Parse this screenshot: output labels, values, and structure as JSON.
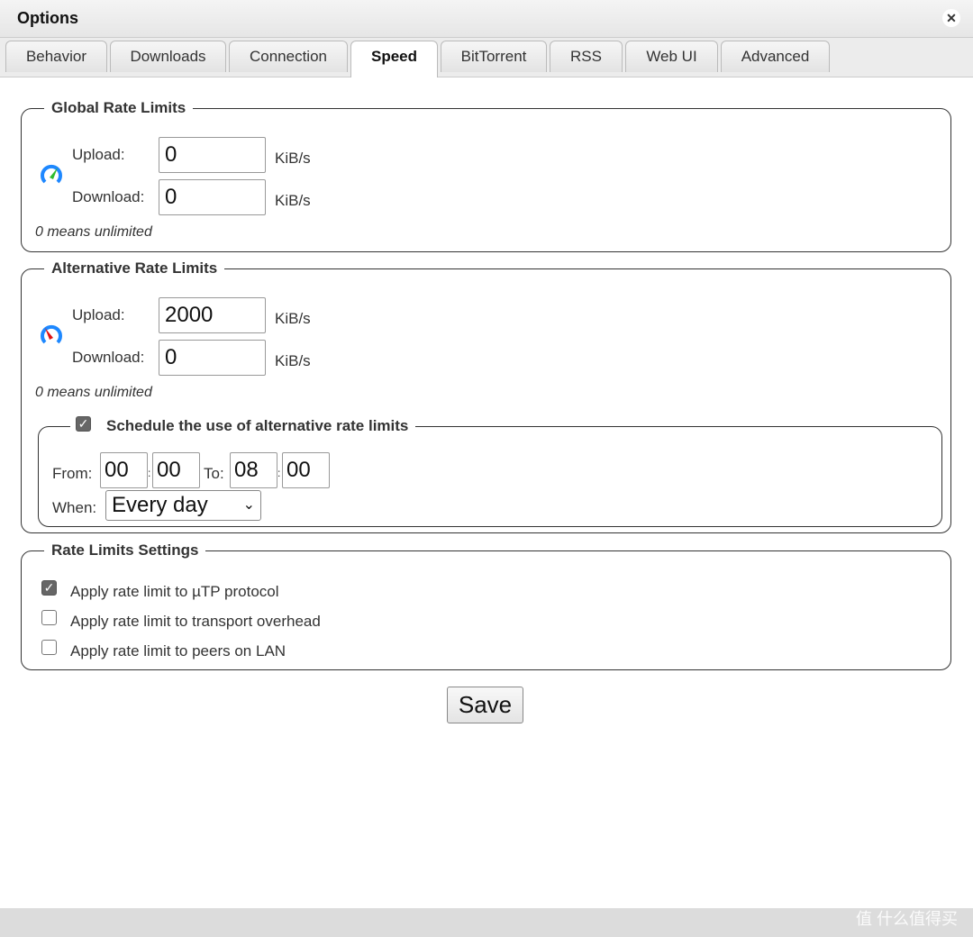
{
  "window": {
    "title": "Options",
    "close_icon": "close-icon"
  },
  "tabs": [
    {
      "label": "Behavior"
    },
    {
      "label": "Downloads"
    },
    {
      "label": "Connection"
    },
    {
      "label": "Speed",
      "active": true
    },
    {
      "label": "BitTorrent"
    },
    {
      "label": "RSS"
    },
    {
      "label": "Web UI"
    },
    {
      "label": "Advanced"
    }
  ],
  "global": {
    "legend": "Global Rate Limits",
    "upload_label": "Upload:",
    "upload_value": "0",
    "download_label": "Download:",
    "download_value": "0",
    "unit": "KiB/s",
    "note": "0 means unlimited",
    "icon": "speedometer-green-icon"
  },
  "alternative": {
    "legend": "Alternative Rate Limits",
    "upload_label": "Upload:",
    "upload_value": "2000",
    "download_label": "Download:",
    "download_value": "0",
    "unit": "KiB/s",
    "note": "0 means unlimited",
    "icon": "speedometer-red-icon",
    "schedule": {
      "label": "Schedule the use of alternative rate limits",
      "checked": true,
      "from_label": "From:",
      "from_h": "00",
      "from_m": "00",
      "to_label": "To:",
      "to_h": "08",
      "to_m": "00",
      "sep": ":",
      "when_label": "When:",
      "when_value": "Every day"
    }
  },
  "settings": {
    "legend": "Rate Limits Settings",
    "items": [
      {
        "label": "Apply rate limit to µTP protocol",
        "checked": true
      },
      {
        "label": "Apply rate limit to transport overhead",
        "checked": false
      },
      {
        "label": "Apply rate limit to peers on LAN",
        "checked": false
      }
    ]
  },
  "save_label": "Save",
  "watermark": "值 什么值得买"
}
